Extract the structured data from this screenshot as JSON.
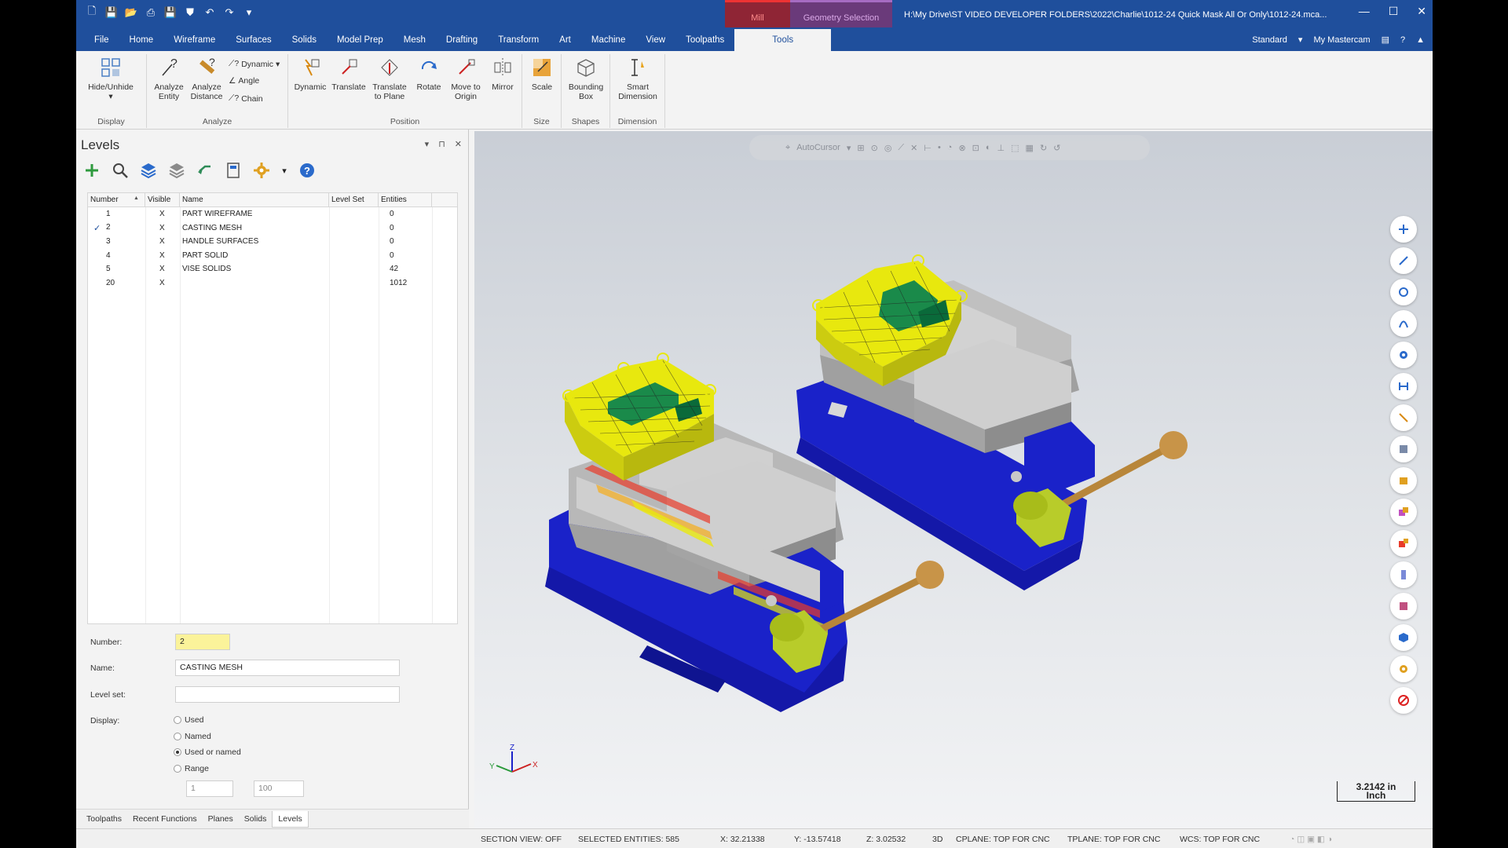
{
  "titlebar": {
    "context_mill": "Mill",
    "context_geometry": "Geometry Selection",
    "path": "H:\\My Drive\\ST VIDEO DEVELOPER FOLDERS\\2022\\Charlie\\1012-24 Quick Mask All Or Only\\1012-24.mca..."
  },
  "menu": {
    "tabs": [
      "File",
      "Home",
      "Wireframe",
      "Surfaces",
      "Solids",
      "Model Prep",
      "Mesh",
      "Drafting",
      "Transform",
      "Art",
      "Machine",
      "View",
      "Toolpaths",
      "Tools"
    ],
    "active": "Tools",
    "workspace": "Standard",
    "my_mastercam": "My Mastercam"
  },
  "ribbon": {
    "display": {
      "label": "Display",
      "hide_unhide": "Hide/Unhide"
    },
    "analyze": {
      "label": "Analyze",
      "entity": "Analyze Entity",
      "distance": "Analyze Distance",
      "dynamic": "Dynamic",
      "angle": "Angle",
      "chain": "Chain"
    },
    "position": {
      "label": "Position",
      "dynamic": "Dynamic",
      "translate": "Translate",
      "translate_plane": "Translate to Plane",
      "rotate": "Rotate",
      "move_origin": "Move to Origin",
      "mirror": "Mirror"
    },
    "size": {
      "label": "Size",
      "scale": "Scale"
    },
    "shapes": {
      "label": "Shapes",
      "bounding_box": "Bounding Box"
    },
    "dimension": {
      "label": "Dimension",
      "smart": "Smart Dimension"
    }
  },
  "levels": {
    "title": "Levels",
    "columns": [
      "Number",
      "Visible",
      "Name",
      "Level Set",
      "Entities"
    ],
    "rows": [
      {
        "number": "1",
        "visible": "X",
        "name": "PART WIREFRAME",
        "level_set": "",
        "entities": "0",
        "active": false
      },
      {
        "number": "2",
        "visible": "X",
        "name": "CASTING MESH",
        "level_set": "",
        "entities": "0",
        "active": true
      },
      {
        "number": "3",
        "visible": "X",
        "name": "HANDLE SURFACES",
        "level_set": "",
        "entities": "0",
        "active": false
      },
      {
        "number": "4",
        "visible": "X",
        "name": "PART SOLID",
        "level_set": "",
        "entities": "0",
        "active": false
      },
      {
        "number": "5",
        "visible": "X",
        "name": "VISE SOLIDS",
        "level_set": "",
        "entities": "42",
        "active": false
      },
      {
        "number": "20",
        "visible": "X",
        "name": "",
        "level_set": "",
        "entities": "1012",
        "active": false
      }
    ],
    "form": {
      "number_label": "Number:",
      "number_value": "2",
      "name_label": "Name:",
      "name_value": "CASTING MESH",
      "level_set_label": "Level set:",
      "level_set_value": "",
      "display_label": "Display:",
      "options": [
        "Used",
        "Named",
        "Used or named",
        "Range"
      ],
      "selected_option": "Used or named",
      "range_from": "1",
      "range_to": "100"
    }
  },
  "bottom_tabs": [
    "Toolpaths",
    "Recent Functions",
    "Planes",
    "Solids",
    "Levels"
  ],
  "bottom_active": "Levels",
  "viewport": {
    "autocursor": "AutoCursor",
    "scale_value": "3.2142 in",
    "scale_unit": "Inch",
    "axis_x": "X",
    "axis_y": "Y",
    "axis_z": "Z"
  },
  "status": {
    "section_view": "SECTION VIEW: OFF",
    "selected": "SELECTED ENTITIES: 585",
    "x": "X:  32.21338",
    "y": "Y:  -13.57418",
    "z": "Z:  3.02532",
    "mode": "3D",
    "cplane": "CPLANE: TOP FOR CNC",
    "tplane": "TPLANE: TOP FOR CNC",
    "wcs": "WCS: TOP FOR CNC"
  },
  "colors": {
    "accent": "#1f4f9c",
    "vise": "#1a22c9",
    "mesh": "#e8e80e"
  }
}
